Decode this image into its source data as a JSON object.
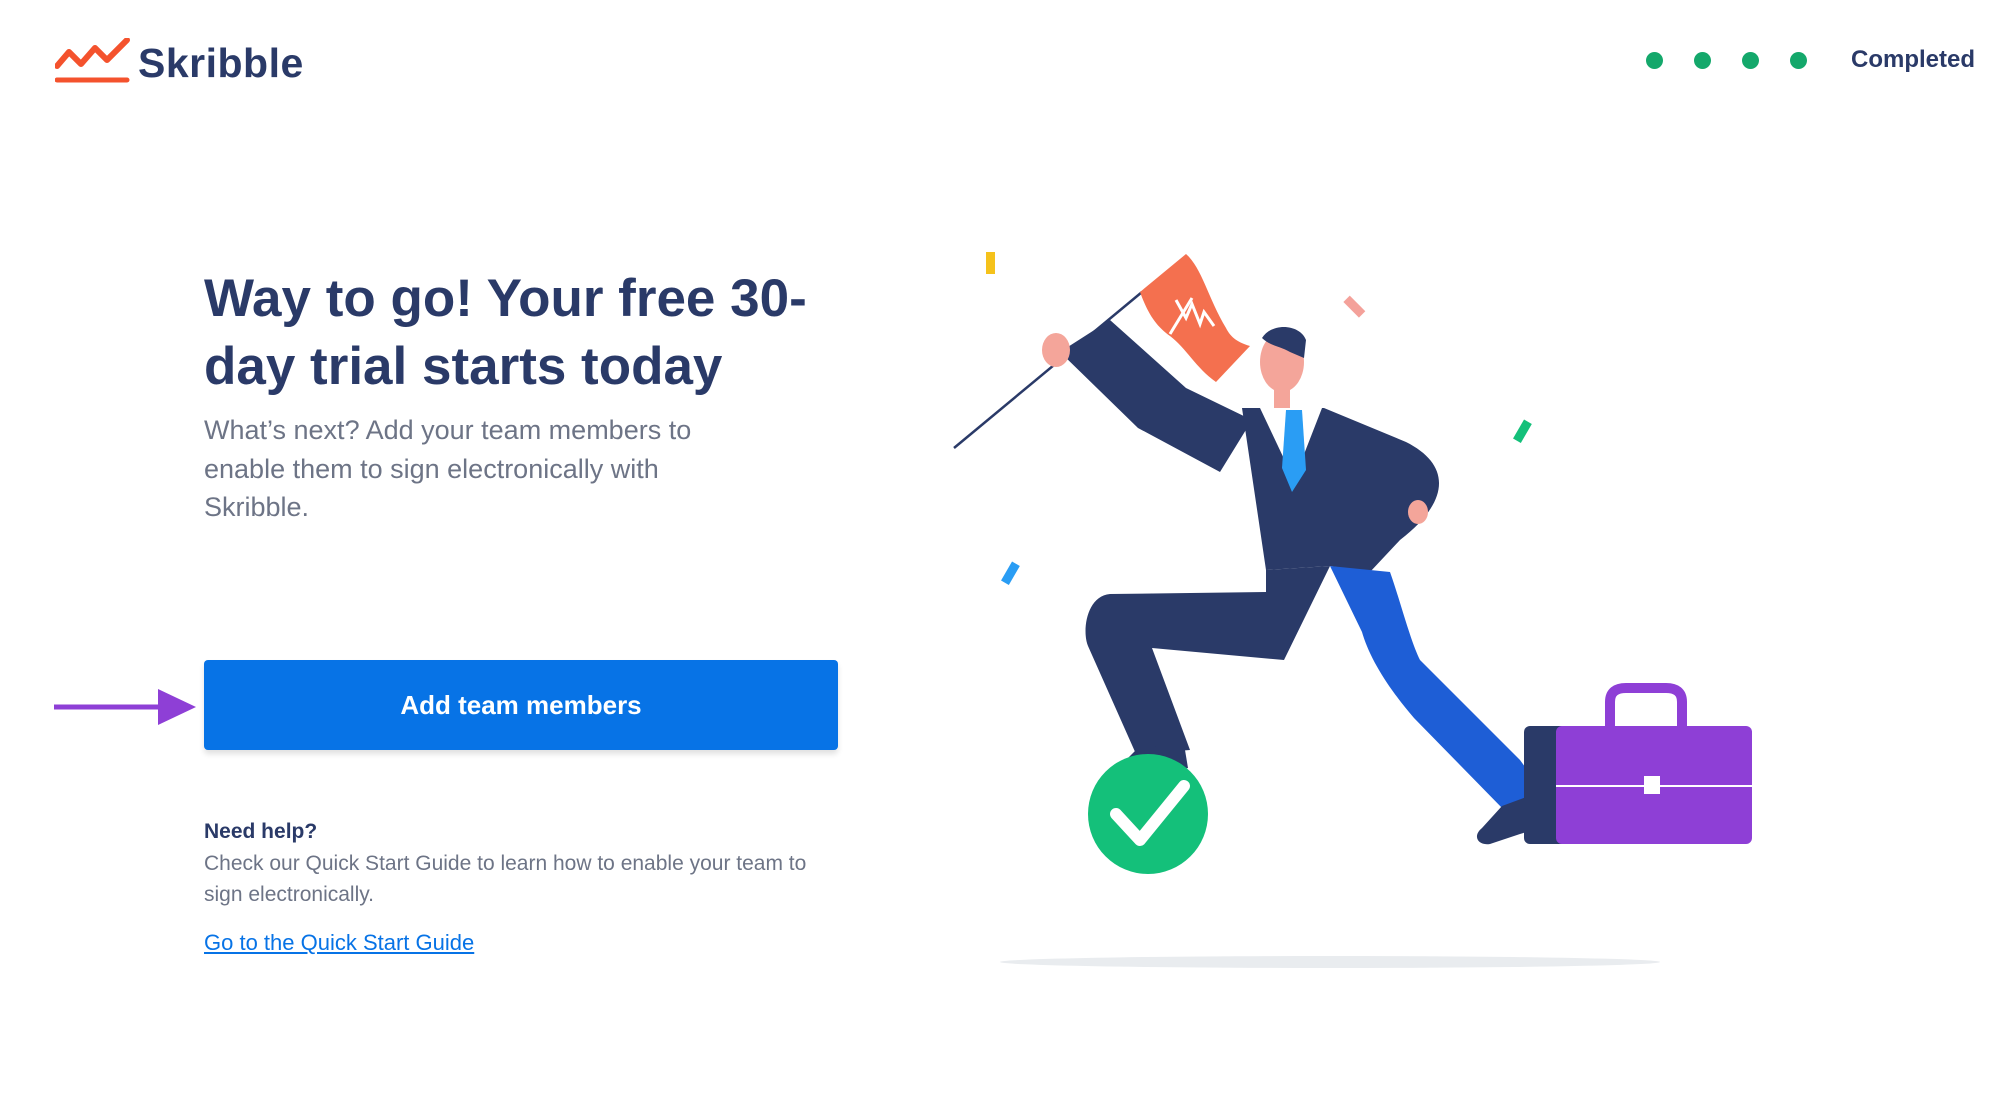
{
  "header": {
    "brand_name": "Skribble",
    "brand_color": "#f4522d",
    "progress": {
      "steps_total": 4,
      "steps_completed": 4,
      "status_label": "Completed",
      "dot_color": "#14a86b"
    }
  },
  "main": {
    "headline": "Way to go! Your free 30-day trial starts today",
    "subtitle": "What’s next? Add your team members to enable them to sign electronically with Skribble.",
    "cta_label": "Add team members",
    "cta_color": "#0773e6",
    "annotation_arrow_color": "#8e3fd6"
  },
  "help": {
    "title": "Need help?",
    "text": "Check our Quick Start Guide to learn how to enable your team to sign electronically.",
    "link_label": "Go to the Quick Start Guide"
  },
  "illustration": {
    "subject": "businessman-with-flag-and-briefcase",
    "icons": [
      "flag-icon",
      "check-icon",
      "briefcase-icon"
    ]
  }
}
